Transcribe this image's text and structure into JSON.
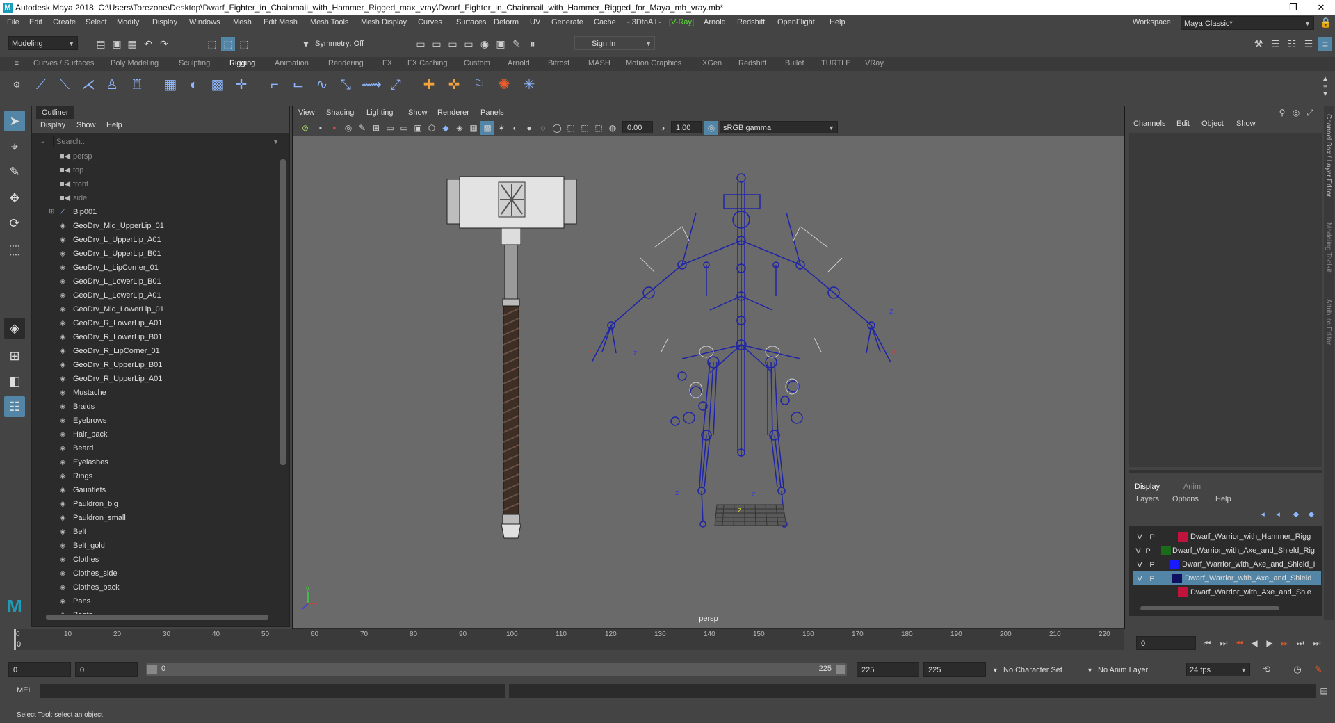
{
  "window": {
    "title": "Autodesk Maya 2018: C:\\Users\\Torezone\\Desktop\\Dwarf_Fighter_in_Chainmail_with_Hammer_Rigged_max_vray\\Dwarf_Fighter_in_Chainmail_with_Hammer_Rigged_for_Maya_mb_vray.mb*",
    "minimize": "—",
    "maximize": "❐",
    "close": "✕"
  },
  "menubar": [
    "File",
    "Edit",
    "Create",
    "Select",
    "Modify",
    "Display",
    "Windows",
    "Mesh",
    "Edit Mesh",
    "Mesh Tools",
    "Mesh Display",
    "Curves",
    "Surfaces",
    "Deform",
    "UV",
    "Generate",
    "Cache",
    "- 3DtoAll -",
    "[V-Ray]",
    "Arnold",
    "Redshift",
    "OpenFlight",
    "Help"
  ],
  "workspace": {
    "label": "Workspace :",
    "value": "Maya Classic*"
  },
  "statusline": {
    "mode": "Modeling",
    "symmetry": "Symmetry: Off",
    "signin": "Sign In"
  },
  "shelf_tabs": [
    "Curves / Surfaces",
    "Poly Modeling",
    "Sculpting",
    "Rigging",
    "Animation",
    "Rendering",
    "FX",
    "FX Caching",
    "Custom",
    "Arnold",
    "Bifrost",
    "MASH",
    "Motion Graphics",
    "XGen",
    "Redshift",
    "Bullet",
    "TURTLE",
    "VRay"
  ],
  "shelf_active": "Rigging",
  "outliner": {
    "tab": "Outliner",
    "menu": [
      "Display",
      "Show",
      "Help"
    ],
    "search_placeholder": "Search...",
    "cameras": [
      "persp",
      "top",
      "front",
      "side"
    ],
    "items": [
      "Bip001",
      "GeoDrv_Mid_UpperLip_01",
      "GeoDrv_L_UpperLip_A01",
      "GeoDrv_L_UpperLip_B01",
      "GeoDrv_L_LipCorner_01",
      "GeoDrv_L_LowerLip_B01",
      "GeoDrv_L_LowerLip_A01",
      "GeoDrv_Mid_LowerLip_01",
      "GeoDrv_R_LowerLip_A01",
      "GeoDrv_R_LowerLip_B01",
      "GeoDrv_R_LipCorner_01",
      "GeoDrv_R_UpperLip_B01",
      "GeoDrv_R_UpperLip_A01",
      "Mustache",
      "Braids",
      "Eyebrows",
      "Hair_back",
      "Beard",
      "Eyelashes",
      "Rings",
      "Gauntlets",
      "Pauldron_big",
      "Pauldron_small",
      "Belt",
      "Belt_gold",
      "Clothes",
      "Clothes_side",
      "Clothes_back",
      "Pans",
      "Boots"
    ]
  },
  "viewport": {
    "menu": [
      "View",
      "Shading",
      "Lighting",
      "Show",
      "Renderer",
      "Panels"
    ],
    "near_value": "0.00",
    "far_value": "1.00",
    "color_space": "sRGB gamma",
    "camera_label": "persp",
    "axis_x": "x",
    "axis_y": "y",
    "axis_z": "z"
  },
  "channelbox": {
    "menu": [
      "Channels",
      "Edit",
      "Object",
      "Show"
    ],
    "side_tabs": [
      "Channel Box / Layer Editor",
      "Modeling Toolkit",
      "Attribute Editor"
    ],
    "layer_tabs": [
      "Display",
      "Anim"
    ],
    "layer_menu": [
      "Layers",
      "Options",
      "Help"
    ],
    "layers": [
      {
        "v": "V",
        "p": "P",
        "color": "#c0143c",
        "name": "Dwarf_Warrior_with_Hammer_Rigg",
        "selected": false
      },
      {
        "v": "V",
        "p": "P",
        "color": "#1a6b1a",
        "name": "Dwarf_Warrior_with_Axe_and_Shield_Rig",
        "selected": false
      },
      {
        "v": "V",
        "p": "P",
        "color": "#1a1aff",
        "name": "Dwarf_Warrior_with_Axe_and_Shield_I",
        "selected": false
      },
      {
        "v": "V",
        "p": "P",
        "color": "#101060",
        "name": "Dwarf_Warrior_with_Axe_and_Shield",
        "selected": true
      },
      {
        "v": "",
        "p": "",
        "color": "#c0143c",
        "name": "Dwarf_Warrior_with_Axe_and_Shie",
        "selected": false
      }
    ]
  },
  "timeline": {
    "ticks": [
      "0",
      "10",
      "20",
      "30",
      "40",
      "50",
      "60",
      "70",
      "80",
      "90",
      "100",
      "110",
      "120",
      "130",
      "140",
      "150",
      "160",
      "170",
      "180",
      "190",
      "200",
      "210",
      "220"
    ],
    "current_frame": "0",
    "current_frame_field": "0"
  },
  "range": {
    "start": "0",
    "start_inner": "0",
    "slider_start": "0",
    "slider_end": "225",
    "end_inner": "225",
    "end": "225",
    "character_set": "No Character Set",
    "anim_layer": "No Anim Layer",
    "fps": "24 fps"
  },
  "mel": {
    "label": "MEL"
  },
  "helpline": "Select Tool: select an object"
}
